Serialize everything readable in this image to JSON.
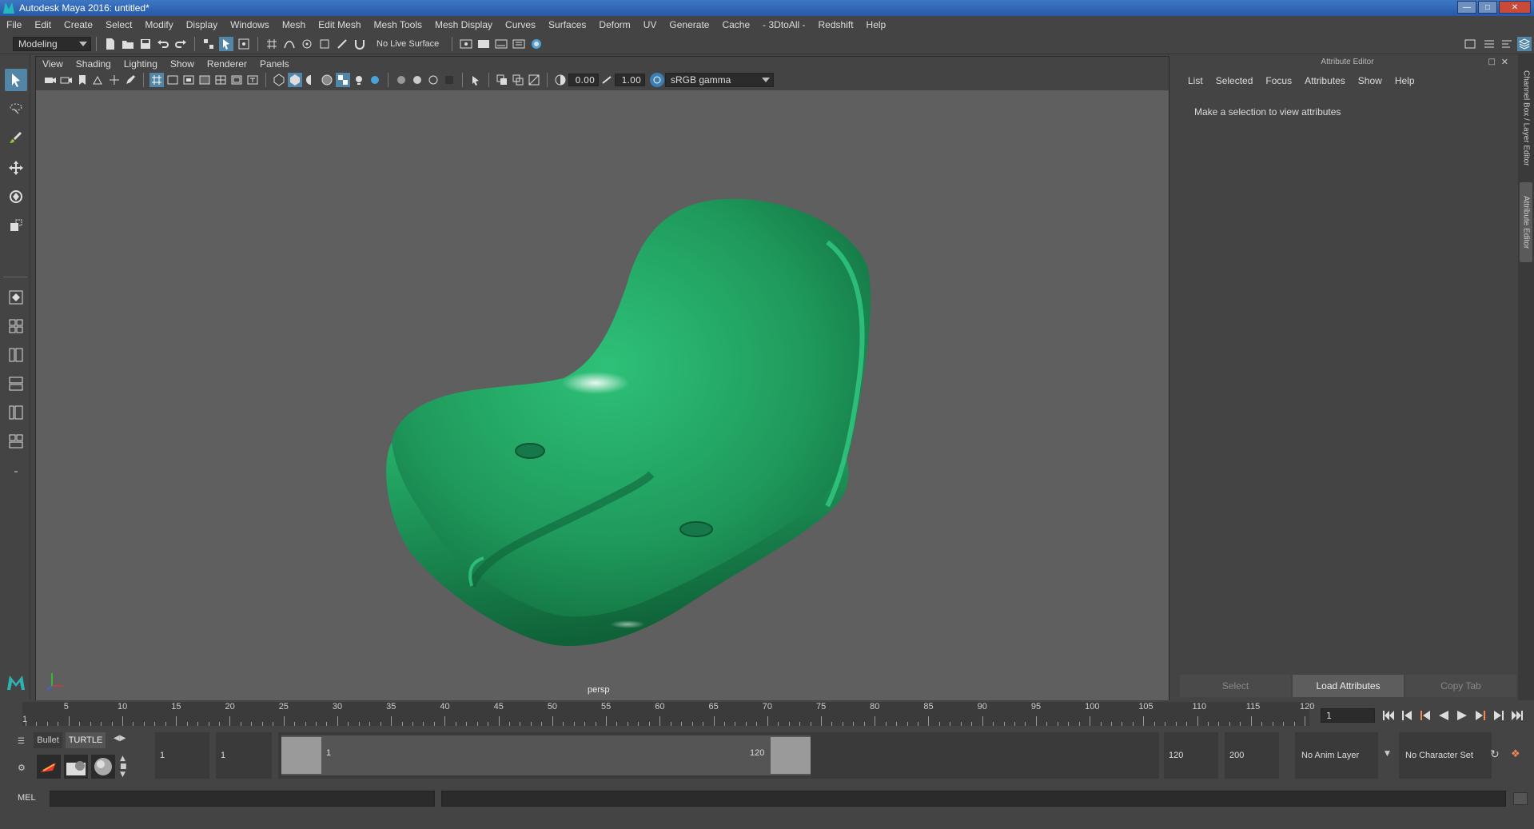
{
  "window": {
    "title": "Autodesk Maya 2016: untitled*"
  },
  "menubar": [
    "File",
    "Edit",
    "Create",
    "Select",
    "Modify",
    "Display",
    "Windows",
    "Mesh",
    "Edit Mesh",
    "Mesh Tools",
    "Mesh Display",
    "Curves",
    "Surfaces",
    "Deform",
    "UV",
    "Generate",
    "Cache",
    "- 3DtoAll -",
    "Redshift",
    "Help"
  ],
  "status_line": {
    "menu_set": "Modeling",
    "live_surface": "No Live Surface"
  },
  "viewport": {
    "menu": [
      "View",
      "Shading",
      "Lighting",
      "Show",
      "Renderer",
      "Panels"
    ],
    "near_value": "0.00",
    "far_value": "1.00",
    "color_space": "sRGB gamma",
    "camera_label": "persp",
    "model_color": "#1f9a5c"
  },
  "attribute_editor": {
    "title": "Attribute Editor",
    "menu": [
      "List",
      "Selected",
      "Focus",
      "Attributes",
      "Show",
      "Help"
    ],
    "message": "Make a selection to view attributes",
    "buttons": {
      "select": "Select",
      "load": "Load Attributes",
      "copy": "Copy Tab"
    }
  },
  "side_tabs": {
    "channel_box": "Channel Box / Layer Editor",
    "attribute_editor": "Attribute Editor"
  },
  "timeline": {
    "ticks": [
      "5",
      "10",
      "15",
      "20",
      "25",
      "30",
      "35",
      "40",
      "45",
      "50",
      "55",
      "60",
      "65",
      "70",
      "75",
      "80",
      "85",
      "90",
      "95",
      "100",
      "105",
      "110",
      "115",
      "120"
    ],
    "start_marker": "1",
    "current_frame": "1"
  },
  "range": {
    "shelf_tabs": [
      "Bullet",
      "TURTLE"
    ],
    "start_time": "1",
    "playback_start": "1",
    "range_start_label": "1",
    "range_end_label": "120",
    "playback_end": "120",
    "end_time": "200",
    "anim_layer": "No Anim Layer",
    "character_set": "No Character Set"
  },
  "command_line": {
    "label": "MEL"
  }
}
